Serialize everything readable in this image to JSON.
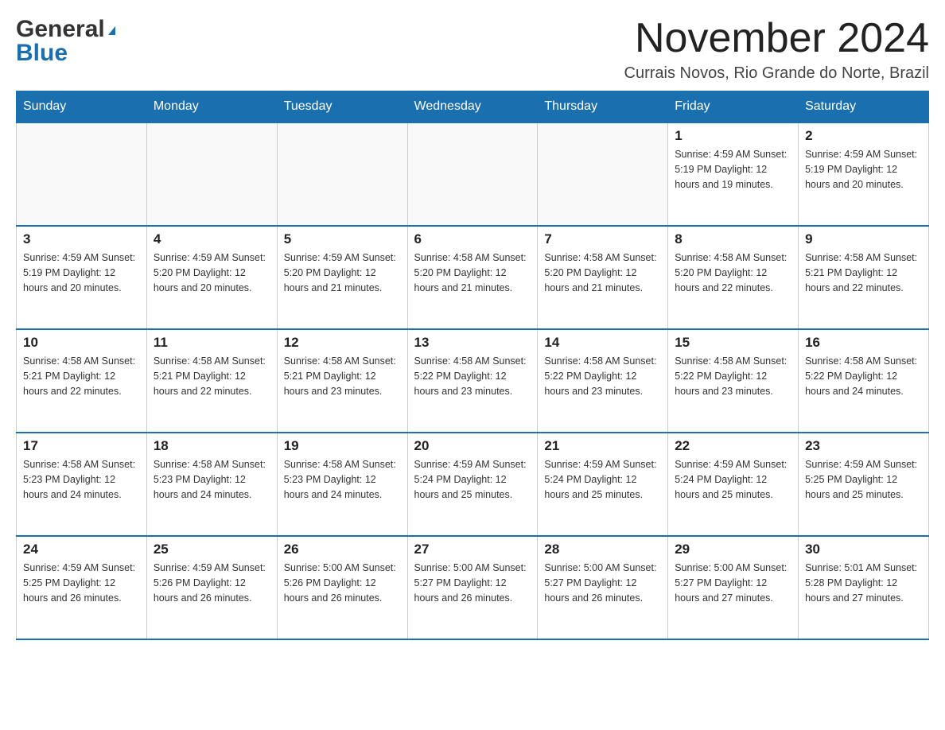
{
  "header": {
    "month_title": "November 2024",
    "location": "Currais Novos, Rio Grande do Norte, Brazil",
    "logo_general": "General",
    "logo_blue": "Blue"
  },
  "calendar": {
    "days_of_week": [
      "Sunday",
      "Monday",
      "Tuesday",
      "Wednesday",
      "Thursday",
      "Friday",
      "Saturday"
    ],
    "weeks": [
      [
        {
          "day": "",
          "info": ""
        },
        {
          "day": "",
          "info": ""
        },
        {
          "day": "",
          "info": ""
        },
        {
          "day": "",
          "info": ""
        },
        {
          "day": "",
          "info": ""
        },
        {
          "day": "1",
          "info": "Sunrise: 4:59 AM\nSunset: 5:19 PM\nDaylight: 12 hours\nand 19 minutes."
        },
        {
          "day": "2",
          "info": "Sunrise: 4:59 AM\nSunset: 5:19 PM\nDaylight: 12 hours\nand 20 minutes."
        }
      ],
      [
        {
          "day": "3",
          "info": "Sunrise: 4:59 AM\nSunset: 5:19 PM\nDaylight: 12 hours\nand 20 minutes."
        },
        {
          "day": "4",
          "info": "Sunrise: 4:59 AM\nSunset: 5:20 PM\nDaylight: 12 hours\nand 20 minutes."
        },
        {
          "day": "5",
          "info": "Sunrise: 4:59 AM\nSunset: 5:20 PM\nDaylight: 12 hours\nand 21 minutes."
        },
        {
          "day": "6",
          "info": "Sunrise: 4:58 AM\nSunset: 5:20 PM\nDaylight: 12 hours\nand 21 minutes."
        },
        {
          "day": "7",
          "info": "Sunrise: 4:58 AM\nSunset: 5:20 PM\nDaylight: 12 hours\nand 21 minutes."
        },
        {
          "day": "8",
          "info": "Sunrise: 4:58 AM\nSunset: 5:20 PM\nDaylight: 12 hours\nand 22 minutes."
        },
        {
          "day": "9",
          "info": "Sunrise: 4:58 AM\nSunset: 5:21 PM\nDaylight: 12 hours\nand 22 minutes."
        }
      ],
      [
        {
          "day": "10",
          "info": "Sunrise: 4:58 AM\nSunset: 5:21 PM\nDaylight: 12 hours\nand 22 minutes."
        },
        {
          "day": "11",
          "info": "Sunrise: 4:58 AM\nSunset: 5:21 PM\nDaylight: 12 hours\nand 22 minutes."
        },
        {
          "day": "12",
          "info": "Sunrise: 4:58 AM\nSunset: 5:21 PM\nDaylight: 12 hours\nand 23 minutes."
        },
        {
          "day": "13",
          "info": "Sunrise: 4:58 AM\nSunset: 5:22 PM\nDaylight: 12 hours\nand 23 minutes."
        },
        {
          "day": "14",
          "info": "Sunrise: 4:58 AM\nSunset: 5:22 PM\nDaylight: 12 hours\nand 23 minutes."
        },
        {
          "day": "15",
          "info": "Sunrise: 4:58 AM\nSunset: 5:22 PM\nDaylight: 12 hours\nand 23 minutes."
        },
        {
          "day": "16",
          "info": "Sunrise: 4:58 AM\nSunset: 5:22 PM\nDaylight: 12 hours\nand 24 minutes."
        }
      ],
      [
        {
          "day": "17",
          "info": "Sunrise: 4:58 AM\nSunset: 5:23 PM\nDaylight: 12 hours\nand 24 minutes."
        },
        {
          "day": "18",
          "info": "Sunrise: 4:58 AM\nSunset: 5:23 PM\nDaylight: 12 hours\nand 24 minutes."
        },
        {
          "day": "19",
          "info": "Sunrise: 4:58 AM\nSunset: 5:23 PM\nDaylight: 12 hours\nand 24 minutes."
        },
        {
          "day": "20",
          "info": "Sunrise: 4:59 AM\nSunset: 5:24 PM\nDaylight: 12 hours\nand 25 minutes."
        },
        {
          "day": "21",
          "info": "Sunrise: 4:59 AM\nSunset: 5:24 PM\nDaylight: 12 hours\nand 25 minutes."
        },
        {
          "day": "22",
          "info": "Sunrise: 4:59 AM\nSunset: 5:24 PM\nDaylight: 12 hours\nand 25 minutes."
        },
        {
          "day": "23",
          "info": "Sunrise: 4:59 AM\nSunset: 5:25 PM\nDaylight: 12 hours\nand 25 minutes."
        }
      ],
      [
        {
          "day": "24",
          "info": "Sunrise: 4:59 AM\nSunset: 5:25 PM\nDaylight: 12 hours\nand 26 minutes."
        },
        {
          "day": "25",
          "info": "Sunrise: 4:59 AM\nSunset: 5:26 PM\nDaylight: 12 hours\nand 26 minutes."
        },
        {
          "day": "26",
          "info": "Sunrise: 5:00 AM\nSunset: 5:26 PM\nDaylight: 12 hours\nand 26 minutes."
        },
        {
          "day": "27",
          "info": "Sunrise: 5:00 AM\nSunset: 5:27 PM\nDaylight: 12 hours\nand 26 minutes."
        },
        {
          "day": "28",
          "info": "Sunrise: 5:00 AM\nSunset: 5:27 PM\nDaylight: 12 hours\nand 26 minutes."
        },
        {
          "day": "29",
          "info": "Sunrise: 5:00 AM\nSunset: 5:27 PM\nDaylight: 12 hours\nand 27 minutes."
        },
        {
          "day": "30",
          "info": "Sunrise: 5:01 AM\nSunset: 5:28 PM\nDaylight: 12 hours\nand 27 minutes."
        }
      ]
    ]
  }
}
